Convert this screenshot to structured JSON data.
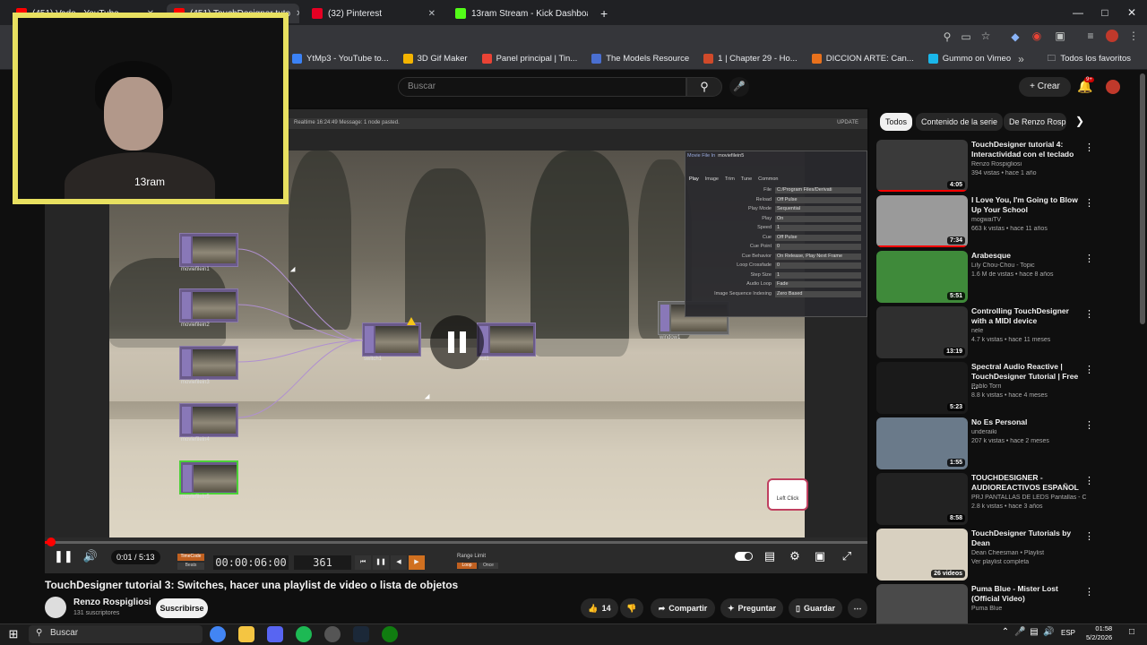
{
  "browser": {
    "tabs": [
      {
        "label": "(451) Vado - YouTube",
        "color": "#ff0000",
        "active": false
      },
      {
        "label": "(451) TouchDesigner tuto",
        "color": "#ff0000",
        "active": true
      },
      {
        "label": "(32) Pinterest",
        "color": "#e60023",
        "active": false
      },
      {
        "label": "13ram Stream - Kick Dashboard",
        "color": "#53fc18",
        "active": false
      }
    ],
    "new_tab": "+",
    "bookmarks": [
      {
        "label": "ciones de Min...",
        "color": "#888888"
      },
      {
        "label": "YtMp3 - YouTube to...",
        "color": "#3b82f6"
      },
      {
        "label": "3D Gif Maker",
        "color": "#f4b400"
      },
      {
        "label": "Panel principal | Tin...",
        "color": "#ea4335"
      },
      {
        "label": "The Models Resource",
        "color": "#4a6fd0"
      },
      {
        "label": "1 | Chapter 29 - Ho...",
        "color": "#d04a2a"
      },
      {
        "label": "DICCION ARTE: Can...",
        "color": "#e8711c"
      },
      {
        "label": "Gummo on Vimeo",
        "color": "#1ab7ea"
      }
    ],
    "all_favorites": "Todos los favoritos"
  },
  "youtube": {
    "search_placeholder": "Buscar",
    "create_label": "Crear",
    "notification_count": "9+",
    "time_current": "0:01",
    "time_total": "5:13",
    "progress_fraction": 0.003,
    "video_title": "TouchDesigner tutorial 3: Switches, hacer una playlist de video o lista de objetos",
    "channel_name": "Renzo Rospigliosi",
    "subscribers": "131 suscriptores",
    "subscribe_label": "Suscribirse",
    "likes": "14",
    "share_label": "Compartir",
    "ask_label": "Preguntar",
    "save_label": "Guardar",
    "chips": [
      "Todos",
      "Contenido de la serie",
      "De Renzo Rospi"
    ]
  },
  "touchdesigner": {
    "status": "Realtime   16:24:49 Message: 1 node pasted.",
    "update_label": "UPDATE",
    "timecode": "00:00:06:00",
    "frame": "361",
    "left_click_label": "Left Click",
    "nodes": [
      "moviefilein1",
      "moviefilein2",
      "moviefilein3",
      "moviefilein4",
      "moviefilein5",
      "switch1",
      "out1",
      "window1"
    ],
    "params_title": "Movie File In",
    "params_node": "moviefilein5",
    "params_tabs": [
      "Play",
      "Image",
      "Trim",
      "Tune",
      "Common"
    ],
    "params": [
      {
        "label": "File",
        "value": "C:/Program Files/Derivati"
      },
      {
        "label": "Reload",
        "value": "Off    Pulse"
      },
      {
        "label": "Play Mode",
        "value": "Sequential"
      },
      {
        "label": "Play",
        "value": "On"
      },
      {
        "label": "Speed",
        "value": "1"
      },
      {
        "label": "Cue",
        "value": "Off    Pulse"
      },
      {
        "label": "Cue Point",
        "value": "0"
      },
      {
        "label": "Cue Behavior",
        "value": "On Release, Play Next Frame"
      },
      {
        "label": "Loop Crossfade",
        "value": "0"
      },
      {
        "label": "Step Size",
        "value": "1"
      },
      {
        "label": "Audio Loop",
        "value": "Fade"
      },
      {
        "label": "Image Sequence Indexing",
        "value": "Zero Based"
      }
    ],
    "range_label": "Range Limit",
    "range_opts": [
      "Loop",
      "Once"
    ],
    "timecode_label": "TimeCode",
    "beats_label": "Beats"
  },
  "webcam": {
    "label": "13ram"
  },
  "recommendations": [
    {
      "title": "TouchDesigner tutorial 4: Interactividad con el teclado",
      "channel": "Renzo Rospigliosi",
      "meta": "394 vistas • hace 1 año",
      "duration": "4:05",
      "thumb": "#3a3a3a",
      "short": false
    },
    {
      "title": "I Love You, I'm Going to Blow Up Your School",
      "channel": "mogwaiTV",
      "meta": "663 k vistas • hace 11 años",
      "duration": "7:34",
      "thumb": "#9a9a9a",
      "short": true
    },
    {
      "title": "Arabesque",
      "channel": "Lily Chou-Chou - Topic",
      "meta": "1.6 M de vistas • hace 8 años",
      "duration": "5:51",
      "thumb": "#3f8a3a",
      "short": true
    },
    {
      "title": "Controlling TouchDesigner with a MIDI device",
      "channel": "nele",
      "meta": "4.7 k vistas • hace 11 meses",
      "duration": "13:19",
      "thumb": "#2f2f2f",
      "short": false
    },
    {
      "title": "Spectral Audio Reactive | TouchDesigner Tutorial | Free ...",
      "channel": "Pablo Torri",
      "meta": "8.8 k vistas • hace 4 meses",
      "duration": "5:23",
      "thumb": "#1a1a1a",
      "short": false
    },
    {
      "title": "No Es Personal",
      "channel": "underaiki",
      "meta": "207 k vistas • hace 2 meses",
      "duration": "1:55",
      "thumb": "#6a7a8a",
      "short": true
    },
    {
      "title": "TOUCHDESIGNER - AUDIOREACTIVOS  ESPAÑOL",
      "channel": "PRJ PANTALLAS DE LEDS Pantallas - Co...",
      "meta": "2.8 k vistas • hace 3 años",
      "duration": "8:58",
      "thumb": "#222222",
      "short": false
    },
    {
      "title": "TouchDesigner Tutorials by Dean",
      "channel": "Dean Cheesman • Playlist",
      "meta": "Ver playlist completa",
      "duration": "26 videos",
      "thumb": "#d8d0c0",
      "short": false
    },
    {
      "title": "Puma Blue - Mister Lost (Official Video)",
      "channel": "Puma Blue",
      "meta": "",
      "duration": "",
      "thumb": "#4a4a4a",
      "short": false
    }
  ],
  "taskbar": {
    "search_placeholder": "Buscar",
    "lang": "ESP",
    "time": "01:58",
    "date": "5/2/2026"
  }
}
